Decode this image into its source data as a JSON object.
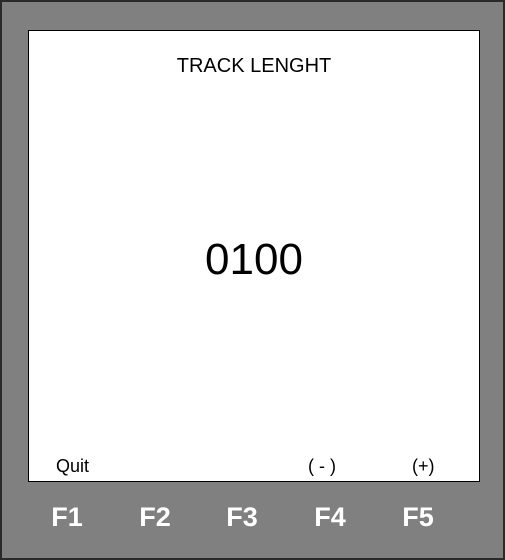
{
  "screen": {
    "title": "TRACK LENGHT",
    "value": "0100"
  },
  "softkey_labels": {
    "f1": "Quit",
    "f2": "",
    "f3": "",
    "f4": "( - )",
    "f5": "(+)"
  },
  "function_keys": {
    "f1": "F1",
    "f2": "F2",
    "f3": "F3",
    "f4": "F4",
    "f5": "F5"
  },
  "colors": {
    "bezel": "#808080",
    "screen_bg": "#ffffff",
    "key_text": "#ffffff"
  }
}
